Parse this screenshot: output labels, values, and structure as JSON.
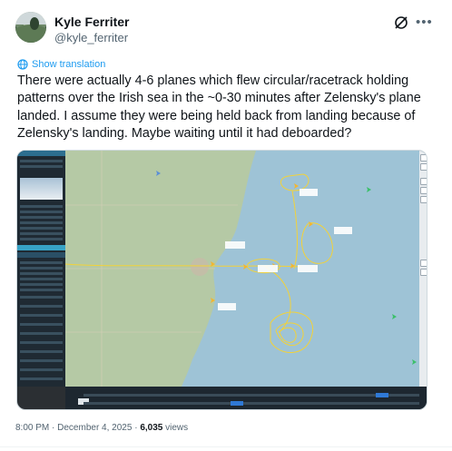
{
  "author": {
    "name": "Kyle Ferriter",
    "handle": "@kyle_ferriter",
    "avatar_icon": "avatar-landscape"
  },
  "header_icons": [
    "grok-icon",
    "more-icon"
  ],
  "translate_label": "Show translation",
  "tweet": {
    "text": "There were actually 4-6 planes which flew circular/racetrack holding patterns over the Irish sea in the ~0-30 minutes after Zelensky's plane landed. I assume they were being held back from landing because of Zelensky's landing. Maybe waiting until it had deboarded?"
  },
  "media": {
    "type": "flight-tracking-map-screenshot",
    "colors": {
      "sea": "#9ec3d6",
      "land": "#b5c9a5",
      "track": "#f2d23a",
      "panel": "#1f2a33"
    }
  },
  "footer": {
    "time": "8:00 PM",
    "date": "December 4, 2025",
    "views_count": "6,035",
    "views_label": "views"
  }
}
